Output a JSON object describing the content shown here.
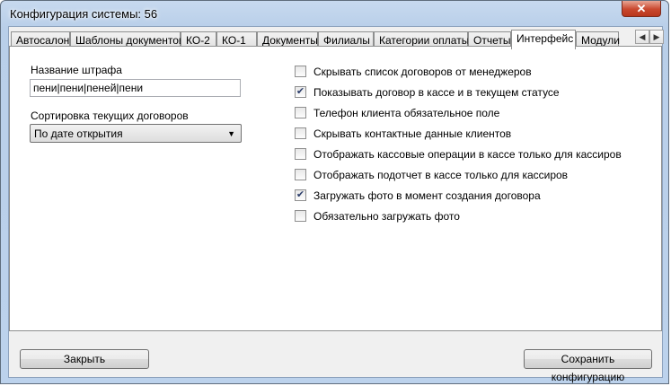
{
  "window": {
    "title": "Конфигурация системы: 56",
    "close_glyph": "✕"
  },
  "tabs": [
    {
      "label": "Автосалон"
    },
    {
      "label": "Шаблоны документов"
    },
    {
      "label": "КО-2"
    },
    {
      "label": "КО-1"
    },
    {
      "label": "Документы"
    },
    {
      "label": "Филиалы"
    },
    {
      "label": "Категории оплаты"
    },
    {
      "label": "Отчеты"
    },
    {
      "label": "Интерфейс"
    },
    {
      "label": "Модули"
    }
  ],
  "active_tab": "Интерфейс",
  "tab_scroll": {
    "left": "◀",
    "right": "▶"
  },
  "fine": {
    "label": "Название штрафа",
    "value": "пени|пени|пеней|пени"
  },
  "sort": {
    "label": "Сортировка текущих договоров",
    "value": "По дате открытия",
    "arrow": "▼"
  },
  "checkboxes": [
    {
      "label": "Скрывать список договоров от менеджеров",
      "checked": false
    },
    {
      "label": "Показывать договор в кассе и в текущем статусе",
      "checked": true
    },
    {
      "label": "Телефон клиента обязательное поле",
      "checked": false
    },
    {
      "label": "Скрывать контактные данные клиентов",
      "checked": false
    },
    {
      "label": "Отображать кассовые операции в кассе только для кассиров",
      "checked": false
    },
    {
      "label": "Отображать подотчет в кассе только для кассиров",
      "checked": false
    },
    {
      "label": "Загружать фото в момент создания договора",
      "checked": true
    },
    {
      "label": "Обязательно загружать фото",
      "checked": false
    }
  ],
  "buttons": {
    "close": "Закрыть",
    "save": "Сохранить конфигурацию"
  }
}
